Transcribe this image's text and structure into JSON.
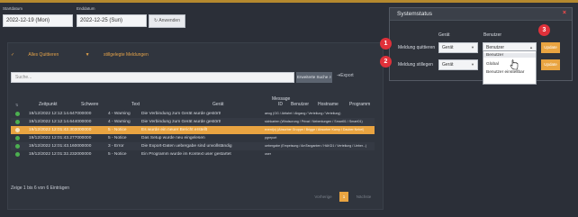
{
  "filters": {
    "start_label": "Startdatum",
    "start_value": "2022-12-19 (Mon)",
    "end_label": "Enddatum",
    "end_value": "2022-12-25 (Sun)",
    "apply_label": "Anwenden"
  },
  "actions": {
    "ack_all": "Alles Quittieren",
    "suppressed": "stillgelegte Meldungen"
  },
  "search": {
    "placeholder": "Suche...",
    "advanced_label": "Erweiterte Suche",
    "export_label": "Export"
  },
  "table": {
    "headers": [
      "Zeitpunkt",
      "Schwere",
      "Text",
      "Gerät",
      "Message ID",
      "Benutzer",
      "Hostname",
      "Programm"
    ],
    "rows": [
      {
        "time": "19/12/2022 12:12:14.647000000",
        "severity": "4 - Warning",
        "text": "Die Verbindung zum Gerät wurde gestört!",
        "device": "aeog (OG / Abfahrt / Abgang / Verteilung / Verteilung)"
      },
      {
        "time": "19/12/2022 12:12:14.644000000",
        "severity": "4 - Warning",
        "text": "Die Verbindung zum Gerät wurde gestört!",
        "device": "sichkarten (Windsorung / Privat / Nebenlungen / Smart01 / Smart01)"
      },
      {
        "time": "19/12/2022 12:01:42.303000000",
        "severity": "5 - Notice",
        "text": "Es wurde ein neuer Bericht erstellt",
        "device": "event(x) (Absorber Gruppe / Brigge / Absorber Kamp / Dauber Nebel)"
      },
      {
        "time": "19/12/2022 12:01:43.277000000",
        "severity": "5 - Notice",
        "text": "Das Setup wurde neu eingelesen",
        "device": "pgreport"
      },
      {
        "time": "19/12/2022 12:01:43.160000000",
        "severity": "3 - Error",
        "text": "Die Export-Daten uebergabe sind unvollständig",
        "device": "uebergabe (Empeisung / AmTanganten / HAKD1 / Verteilung / Ueber...)"
      },
      {
        "time": "19/12/2022 12:01:32.232000000",
        "severity": "5 - Notice",
        "text": "Ein Programm wurde im Kontext user gestartet",
        "device": "user"
      }
    ]
  },
  "footer": {
    "info": "Zeige 1 bis 6 von 6 Einträgen",
    "prev": "Vorherige",
    "page": "1",
    "next": "Nächste"
  },
  "dialog": {
    "title": "Systemstatus",
    "close": "×",
    "col_device": "Gerät",
    "col_user": "Benutzer",
    "row1_label": "Meldung quittieren",
    "row2_label": "Meldung stillegen",
    "device_value": "Gerät",
    "user_value": "Benutzer",
    "update_label": "Update",
    "dropdown_options": [
      "Benutzer",
      "Global",
      "Benutzer einstellbar"
    ]
  },
  "badges": [
    "1",
    "2",
    "3"
  ],
  "colors": {
    "accent": "#e9a441",
    "badge": "#e0313a",
    "ok": "#4caf50",
    "background": "#2b2f38"
  }
}
